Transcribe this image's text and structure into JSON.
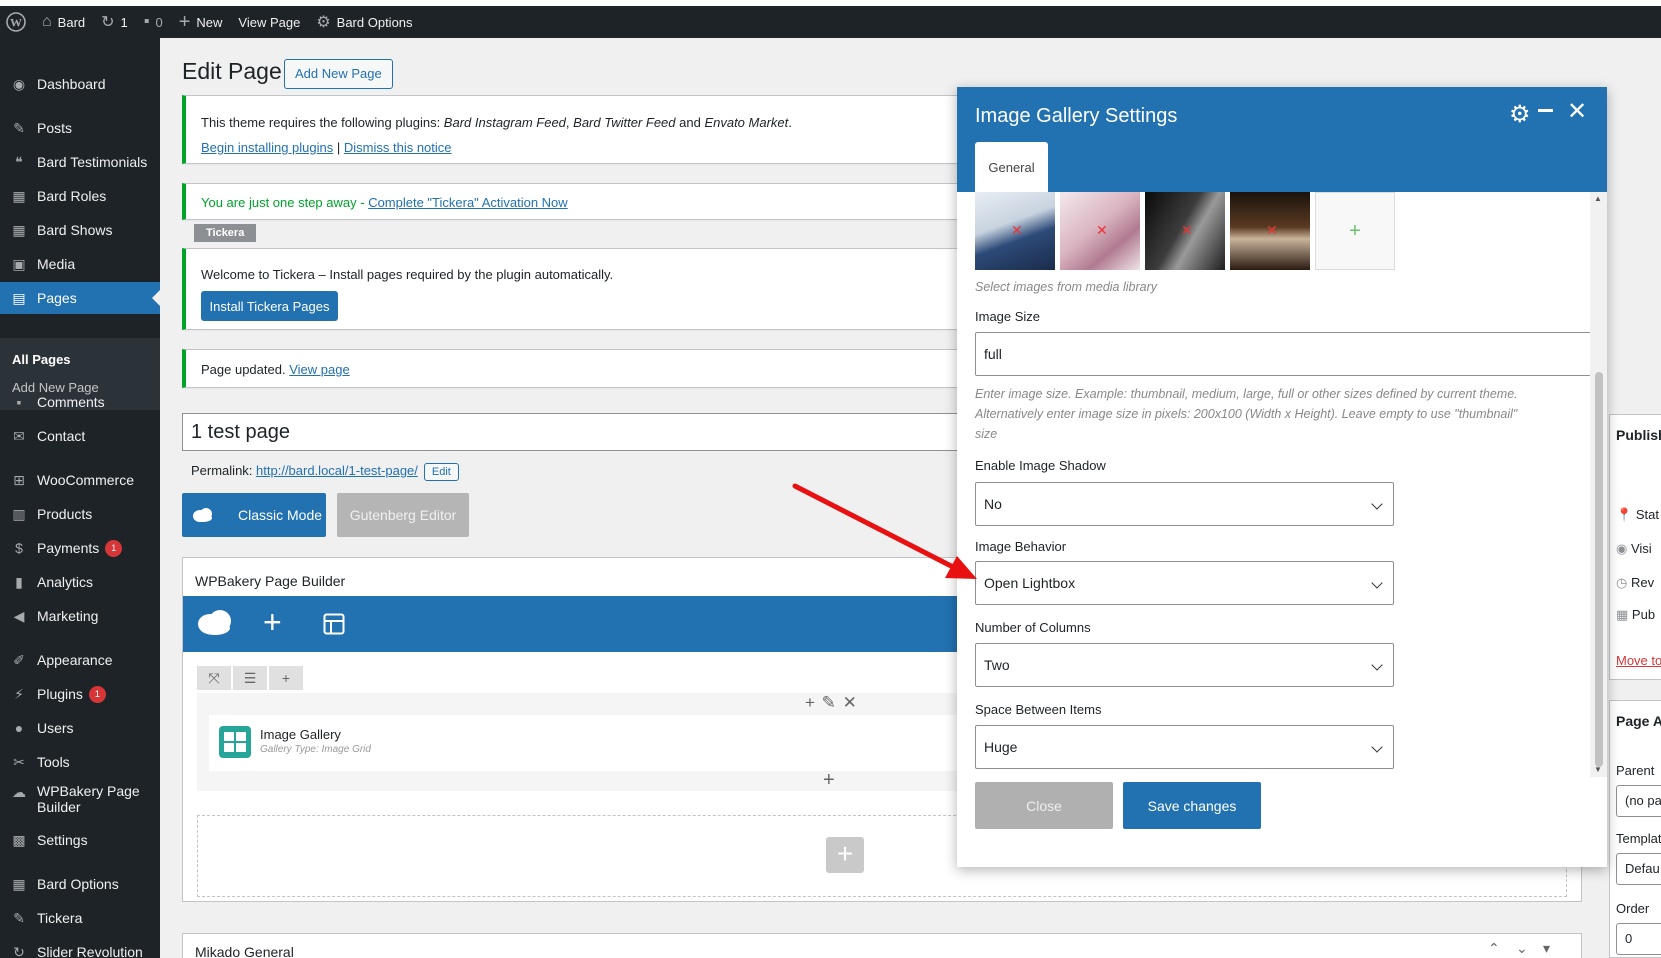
{
  "adminbar": {
    "site_name": "Bard",
    "updates_count": "1",
    "comments_count": "0",
    "new_label": "New",
    "view_page_label": "View Page",
    "bard_options_label": "Bard Options"
  },
  "sidebar": {
    "items": [
      {
        "label": "Dashboard",
        "icon": "dashboard-icon"
      },
      {
        "label": "Posts",
        "icon": "pin-icon"
      },
      {
        "label": "Bard Testimonials",
        "icon": "quote-icon"
      },
      {
        "label": "Bard Roles",
        "icon": "grid-icon"
      },
      {
        "label": "Bard Shows",
        "icon": "grid-icon"
      },
      {
        "label": "Media",
        "icon": "media-icon"
      },
      {
        "label": "Pages",
        "icon": "page-icon"
      },
      {
        "label": "Comments",
        "icon": "comment-icon"
      },
      {
        "label": "Contact",
        "icon": "mail-icon"
      },
      {
        "label": "WooCommerce",
        "icon": "woo-icon"
      },
      {
        "label": "Products",
        "icon": "archive-icon"
      },
      {
        "label": "Payments",
        "icon": "dollar-icon",
        "badge": "1"
      },
      {
        "label": "Analytics",
        "icon": "bar-chart-icon"
      },
      {
        "label": "Marketing",
        "icon": "megaphone-icon"
      },
      {
        "label": "Appearance",
        "icon": "brush-icon"
      },
      {
        "label": "Plugins",
        "icon": "plugin-icon",
        "badge": "1"
      },
      {
        "label": "Users",
        "icon": "user-icon"
      },
      {
        "label": "Tools",
        "icon": "wrench-icon"
      },
      {
        "label": "WPBakery Page",
        "label2": "Builder",
        "icon": "cloud-icon"
      },
      {
        "label": "Settings",
        "icon": "settings-icon"
      },
      {
        "label": "Bard Options",
        "icon": "grid-icon"
      },
      {
        "label": "Tickera",
        "icon": "pin-icon"
      },
      {
        "label": "Slider Revolution",
        "icon": "refresh-icon"
      }
    ],
    "sub_items": [
      "All Pages",
      "Add New Page"
    ]
  },
  "main": {
    "heading": "Edit Page",
    "add_new_label": "Add New Page",
    "notice1": {
      "prefix": "This theme requires the following plugins: ",
      "plugin1": "Bard Instagram Feed",
      "sep1": ", ",
      "plugin2": "Bard Twitter Feed",
      "sep2": " and ",
      "plugin3": "Envato Market",
      "suffix": ".",
      "link1": "Begin installing plugins",
      "divider": " | ",
      "link2": "Dismiss this notice"
    },
    "notice2": {
      "prefix": "You are just one step away - ",
      "link": "Complete \"Tickera\" Activation Now"
    },
    "tag": "Tickera",
    "notice3": {
      "text": "Welcome to Tickera – Install pages required by the plugin automatically.",
      "button": "Install Tickera Pages"
    },
    "notice4": {
      "text": "Page updated. ",
      "link": "View page"
    },
    "title_value": "1 test page",
    "permalink_label": "Permalink: ",
    "permalink_url": "http://bard.local/1-test-page/",
    "permalink_edit": "Edit",
    "classic_mode_label": "Classic Mode",
    "gutenberg_label": "Gutenberg Editor",
    "wpb_title": "WPBakery Page Builder",
    "element_title": "Image Gallery",
    "element_sub": "Gallery Type: Image Grid",
    "mikado_label": "Mikado General"
  },
  "side": {
    "publish_title": "Publish",
    "status": "Stat",
    "visibility": "Visi",
    "revisions": "Rev",
    "published": "Pub",
    "move_to": "Move to",
    "page_attr_title": "Page A",
    "parent_label": "Parent",
    "parent_value": "(no pa",
    "template_label": "Templat",
    "template_value": "Defau",
    "order_label": "Order",
    "order_value": "0"
  },
  "modal": {
    "title": "Image Gallery Settings",
    "tab_general": "General",
    "images_help": "Select images from media library",
    "image_size_label": "Image Size",
    "image_size_value": "full",
    "image_size_help1": "Enter image size. Example: thumbnail, medium, large, full or other sizes defined by current theme.",
    "image_size_help2": "Alternatively enter image size in pixels: 200x100 (Width x Height). Leave empty to use \"thumbnail\"",
    "image_size_help3": "size",
    "shadow_label": "Enable Image Shadow",
    "shadow_value": "No",
    "behavior_label": "Image Behavior",
    "behavior_value": "Open Lightbox",
    "columns_label": "Number of Columns",
    "columns_value": "Two",
    "space_label": "Space Between Items",
    "space_value": "Huge",
    "close_label": "Close",
    "save_label": "Save changes"
  },
  "colors": {
    "accent": "#2271b1",
    "admin_dark": "#1d2327",
    "notice_green": "#00a32a",
    "badge_red": "#d63638",
    "arrow_red": "#e81010"
  }
}
